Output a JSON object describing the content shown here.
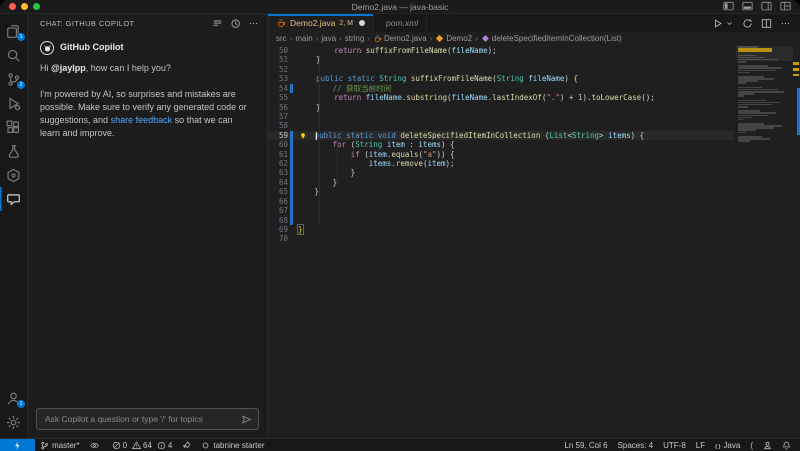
{
  "titlebar": {
    "title": "Demo2.java — java-basic",
    "layout_icons": [
      "toggle-primary-sidebar",
      "toggle-panel",
      "toggle-secondary-sidebar",
      "customize-layout"
    ]
  },
  "activity_bar": {
    "top": [
      {
        "name": "explorer",
        "icon": "files",
        "badge": "1"
      },
      {
        "name": "search",
        "icon": "search"
      },
      {
        "name": "source-control",
        "icon": "branch",
        "badge": "2"
      },
      {
        "name": "run-and-debug",
        "icon": "debug"
      },
      {
        "name": "extensions",
        "icon": "extensions"
      },
      {
        "name": "testing",
        "icon": "beaker"
      },
      {
        "name": "java-projects",
        "icon": "hexagon"
      },
      {
        "name": "copilot-chat",
        "icon": "chat",
        "active": true
      }
    ],
    "bottom": [
      {
        "name": "accounts",
        "icon": "account",
        "badge": "1"
      },
      {
        "name": "settings",
        "icon": "gear"
      }
    ]
  },
  "chat": {
    "title": "CHAT: GITHUB COPILOT",
    "header_actions": [
      "clear",
      "history",
      "more"
    ],
    "assistant": "GitHub Copilot",
    "greeting": [
      {
        "t": "Hi "
      },
      {
        "t": "@jaylpp",
        "b": true
      },
      {
        "t": ", how can I help you?"
      }
    ],
    "body": [
      {
        "t": "I'm powered by AI, so surprises and mistakes are possible. Make sure to verify any generated code or suggestions, and "
      },
      {
        "t": "share feedback",
        "link": true
      },
      {
        "t": " so that we can learn and improve."
      }
    ],
    "input_placeholder": "Ask Copilot a question or type '/' for topics"
  },
  "tabs": [
    {
      "label": "Demo2.java",
      "badge": "2, M",
      "icon": "java",
      "active": true,
      "dirty": true,
      "modified": true
    },
    {
      "label": "pom.xml",
      "icon": "xml",
      "italic": true
    }
  ],
  "editor_actions": [
    "run",
    "chevron-down",
    "sync",
    "split-editor",
    "more"
  ],
  "breadcrumb": [
    {
      "label": "src"
    },
    {
      "label": "main"
    },
    {
      "label": "java"
    },
    {
      "label": "string"
    },
    {
      "label": "Demo2.java",
      "icon": "java"
    },
    {
      "label": "Demo2",
      "icon": "class"
    },
    {
      "label": "deleteSpecifiedItemInCollection(List<String>)",
      "icon": "method"
    }
  ],
  "editor": {
    "lines": [
      {
        "n": 50,
        "tokens": [
          [
            "p",
            "        "
          ],
          [
            "c",
            "return"
          ],
          [
            "p",
            " "
          ],
          [
            "f",
            "suffixFromFileName"
          ],
          [
            "p",
            "("
          ],
          [
            "v",
            "fileName"
          ],
          [
            "p",
            ");"
          ]
        ]
      },
      {
        "n": 51,
        "tokens": [
          [
            "p",
            "    }"
          ]
        ]
      },
      {
        "n": 52,
        "tokens": []
      },
      {
        "n": 53,
        "tokens": [
          [
            "p",
            "    "
          ],
          [
            "k",
            "public"
          ],
          [
            "p",
            " "
          ],
          [
            "k",
            "static"
          ],
          [
            "p",
            " "
          ],
          [
            "t",
            "String"
          ],
          [
            "p",
            " "
          ],
          [
            "f",
            "suffixFromFileName"
          ],
          [
            "p",
            "("
          ],
          [
            "t",
            "String"
          ],
          [
            "p",
            " "
          ],
          [
            "v",
            "fileName"
          ],
          [
            "p",
            ") {"
          ]
        ]
      },
      {
        "n": 54,
        "marker": true,
        "tokens": [
          [
            "p",
            "        "
          ],
          [
            "m",
            "// 获取当前时间"
          ]
        ]
      },
      {
        "n": 55,
        "tokens": [
          [
            "p",
            "        "
          ],
          [
            "c",
            "return"
          ],
          [
            "p",
            " "
          ],
          [
            "v",
            "fileName"
          ],
          [
            "p",
            "."
          ],
          [
            "f",
            "substring"
          ],
          [
            "p",
            "("
          ],
          [
            "v",
            "fileName"
          ],
          [
            "p",
            "."
          ],
          [
            "f",
            "lastIndexOf"
          ],
          [
            "p",
            "("
          ],
          [
            "s",
            "\".\""
          ],
          [
            "p",
            ") + "
          ],
          [
            "n",
            "1"
          ],
          [
            "p",
            ")."
          ],
          [
            "f",
            "toLowerCase"
          ],
          [
            "p",
            "();"
          ]
        ]
      },
      {
        "n": 56,
        "tokens": [
          [
            "p",
            "    }"
          ]
        ]
      },
      {
        "n": 57,
        "tokens": []
      },
      {
        "n": 58,
        "tokens": []
      },
      {
        "n": 59,
        "marker": true,
        "current": true,
        "lightbulb": true,
        "cursor": true,
        "tokens": [
          [
            "p",
            "    "
          ],
          [
            "k",
            "public"
          ],
          [
            "p",
            " "
          ],
          [
            "k",
            "static"
          ],
          [
            "p",
            " "
          ],
          [
            "k",
            "void"
          ],
          [
            "p",
            " "
          ],
          [
            "f",
            "deleteSpecifiedItemInCollection"
          ],
          [
            "p",
            " ("
          ],
          [
            "t",
            "List"
          ],
          [
            "p",
            "<"
          ],
          [
            "t",
            "String"
          ],
          [
            "p",
            "> "
          ],
          [
            "v",
            "items"
          ],
          [
            "p",
            ") {"
          ]
        ]
      },
      {
        "n": 60,
        "marker": true,
        "tokens": [
          [
            "p",
            "        "
          ],
          [
            "c",
            "for"
          ],
          [
            "p",
            " ("
          ],
          [
            "t",
            "String"
          ],
          [
            "p",
            " "
          ],
          [
            "v",
            "item"
          ],
          [
            "p",
            " : "
          ],
          [
            "v",
            "items"
          ],
          [
            "p",
            ") {"
          ]
        ]
      },
      {
        "n": 61,
        "marker": true,
        "tokens": [
          [
            "p",
            "            "
          ],
          [
            "c",
            "if"
          ],
          [
            "p",
            " ("
          ],
          [
            "v",
            "item"
          ],
          [
            "p",
            "."
          ],
          [
            "f",
            "equals"
          ],
          [
            "p",
            "("
          ],
          [
            "s",
            "\"a\""
          ],
          [
            "p",
            ")) {"
          ]
        ]
      },
      {
        "n": 62,
        "marker": true,
        "tokens": [
          [
            "p",
            "                "
          ],
          [
            "v",
            "items"
          ],
          [
            "p",
            "."
          ],
          [
            "f",
            "remove"
          ],
          [
            "p",
            "("
          ],
          [
            "v",
            "item"
          ],
          [
            "p",
            ");"
          ]
        ]
      },
      {
        "n": 63,
        "marker": true,
        "tokens": [
          [
            "p",
            "            }"
          ]
        ]
      },
      {
        "n": 64,
        "marker": true,
        "tokens": [
          [
            "p",
            "        }"
          ]
        ]
      },
      {
        "n": 65,
        "marker": true,
        "tokens": [
          [
            "p",
            "    }"
          ]
        ]
      },
      {
        "n": 66,
        "marker": true,
        "tokens": []
      },
      {
        "n": 67,
        "marker": true,
        "tokens": []
      },
      {
        "n": 68,
        "marker": true,
        "tokens": []
      },
      {
        "n": 69,
        "tokens": [
          [
            "y",
            "}"
          ]
        ]
      },
      {
        "n": 70,
        "tokens": []
      }
    ]
  },
  "status_left": [
    {
      "name": "remote-indicator",
      "icon": "zap",
      "accent": true
    },
    {
      "name": "git-branch",
      "icon": "branch",
      "label": "master*"
    },
    {
      "name": "gitlens-toggle",
      "icon": "eye"
    },
    {
      "name": "problems",
      "problems": {
        "errors": "0",
        "warnings": "64",
        "infos": "4"
      }
    },
    {
      "name": "launch",
      "icon": "rocket"
    },
    {
      "name": "tabnine",
      "icon": "circle-o",
      "label": "tabnine starter"
    }
  ],
  "status_right": [
    {
      "name": "cursor-position",
      "label": "Ln 59, Col 6"
    },
    {
      "name": "indentation",
      "label": "Spaces: 4"
    },
    {
      "name": "encoding",
      "label": "UTF-8"
    },
    {
      "name": "eol",
      "label": "LF"
    },
    {
      "name": "language-mode",
      "icon": "braces",
      "label": "Java"
    },
    {
      "name": "paren-status",
      "label": "("
    },
    {
      "name": "feedback",
      "icon": "person"
    },
    {
      "name": "notifications",
      "icon": "bell"
    }
  ],
  "colors": {
    "accent": "#0078d4",
    "modified_tab": "#e2c08d",
    "gutter_marker": "#2472c8",
    "link": "#4daafc"
  }
}
